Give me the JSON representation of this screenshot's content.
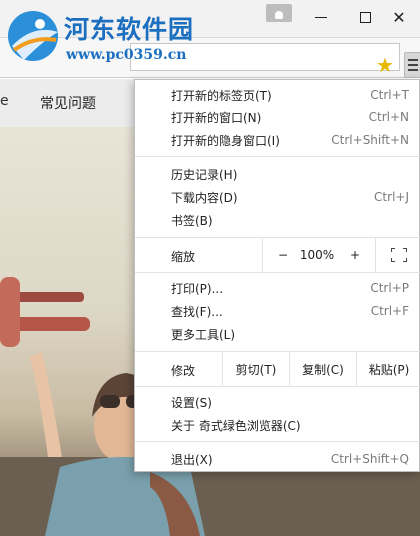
{
  "brand": {
    "name": "河东软件园",
    "url": "www.pc0359.cn"
  },
  "window": {
    "minimize_icon": "minimize-icon",
    "maximize_icon": "maximize-icon",
    "close_icon": "close-icon",
    "close_glyph": "✕"
  },
  "toolbar": {
    "bookmark_icon": "star-icon",
    "star_glyph": "★",
    "menu_icon": "hamburger-menu-icon"
  },
  "page": {
    "nav_prefix": "e",
    "nav_faq": "常见问题"
  },
  "menu": {
    "new_tab": {
      "label": "打开新的标签页(T)",
      "shortcut": "Ctrl+T"
    },
    "new_window": {
      "label": "打开新的窗口(N)",
      "shortcut": "Ctrl+N"
    },
    "new_incognito": {
      "label": "打开新的隐身窗口(I)",
      "shortcut": "Ctrl+Shift+N"
    },
    "history": {
      "label": "历史记录(H)",
      "arrow": "›"
    },
    "downloads": {
      "label": "下载内容(D)",
      "shortcut": "Ctrl+J"
    },
    "bookmarks": {
      "label": "书签(B)",
      "arrow": "›"
    },
    "zoom": {
      "label": "缩放",
      "minus": "−",
      "value": "100%",
      "plus": "+"
    },
    "print": {
      "label": "打印(P)...",
      "shortcut": "Ctrl+P"
    },
    "find": {
      "label": "查找(F)...",
      "shortcut": "Ctrl+F"
    },
    "more_tools": {
      "label": "更多工具(L)",
      "arrow": "›"
    },
    "edit": {
      "label": "修改",
      "cut": "剪切(T)",
      "copy": "复制(C)",
      "paste": "粘贴(P)"
    },
    "settings": {
      "label": "设置(S)"
    },
    "about": {
      "label": "关于 奇式绿色浏览器(C)"
    },
    "exit": {
      "label": "退出(X)",
      "shortcut": "Ctrl+Shift+Q"
    }
  }
}
